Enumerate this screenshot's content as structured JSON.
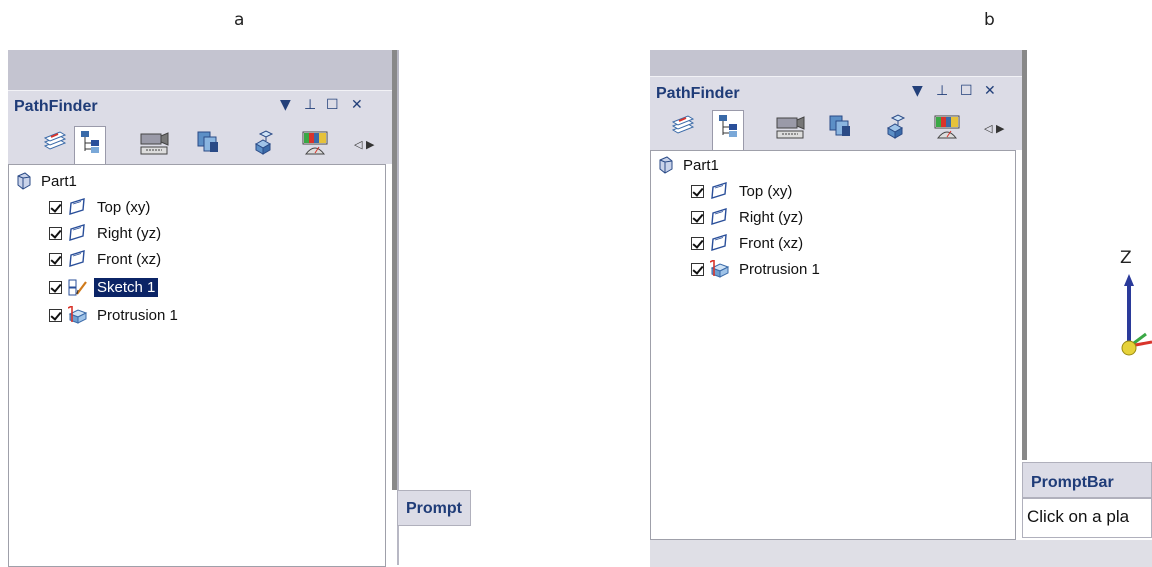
{
  "labels": {
    "a": "a",
    "b": "b"
  },
  "pathfinder": {
    "title": "PathFinder",
    "controls": {
      "dropdown": "▼",
      "pin": "⊥",
      "maximize": "☐",
      "close": "✕"
    },
    "tab_icons": [
      "layers-icon",
      "feature-tree-icon",
      "camera-icon",
      "views-icon",
      "assembly-icon",
      "color-meter-icon"
    ],
    "scroll_arrows": "◁ ▶"
  },
  "panel_a": {
    "root": "Part1",
    "items": [
      {
        "label": "Top (xy)",
        "icon": "plane-icon",
        "checked": true,
        "selected": false
      },
      {
        "label": "Right (yz)",
        "icon": "plane-icon",
        "checked": true,
        "selected": false
      },
      {
        "label": "Front (xz)",
        "icon": "plane-icon",
        "checked": true,
        "selected": false
      },
      {
        "label": "Sketch 1",
        "icon": "sketch-icon",
        "checked": true,
        "selected": true
      },
      {
        "label": "Protrusion 1",
        "icon": "protrusion-icon",
        "checked": true,
        "selected": false
      }
    ],
    "prompt_tab": "Prompt"
  },
  "panel_b": {
    "root": "Part1",
    "items": [
      {
        "label": "Top (xy)",
        "icon": "plane-icon",
        "checked": true
      },
      {
        "label": "Right (yz)",
        "icon": "plane-icon",
        "checked": true
      },
      {
        "label": "Front (xz)",
        "icon": "plane-icon",
        "checked": true
      },
      {
        "label": "Protrusion 1",
        "icon": "protrusion-icon",
        "checked": true
      }
    ],
    "prompt_tab": "PromptBar",
    "prompt_text": "Click on a pla",
    "axis_label": "Z"
  }
}
